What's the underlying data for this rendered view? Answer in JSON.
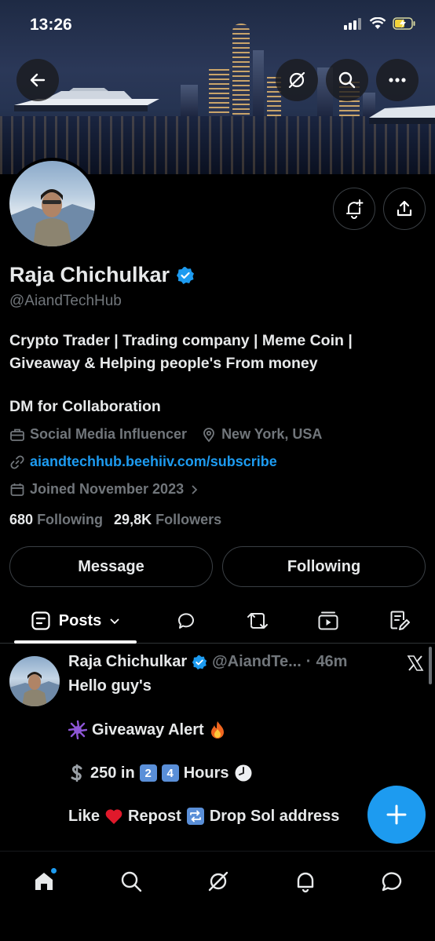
{
  "status_bar": {
    "time": "13:26"
  },
  "profile": {
    "name": "Raja Chichulkar",
    "handle": "@AiandTechHub",
    "bio_line1": "Crypto Trader | Trading company | Meme Coin |",
    "bio_line2": "Giveaway & Helping people's From money",
    "dm_line": "DM for Collaboration",
    "category": "Social Media Influencer",
    "location": "New York, USA",
    "website": "aiandtechhub.beehiiv.com/subscribe",
    "joined": "Joined November 2023",
    "following_count": "680",
    "following_label": "Following",
    "followers_count": "29,8K",
    "followers_label": "Followers"
  },
  "actions": {
    "message_label": "Message",
    "following_label": "Following"
  },
  "tabs": {
    "posts_label": "Posts"
  },
  "post": {
    "author": "Raja Chichulkar",
    "handle": "@AiandTe...",
    "separator": "·",
    "time": "46m",
    "line1": "Hello guy's",
    "line2": "Giveaway Alert",
    "line3_amount": "250 in",
    "line3_d1": "2",
    "line3_d2": "4",
    "line3_suffix": "Hours",
    "line4_a": "Like",
    "line4_b": "Repost",
    "line4_c": "Drop Sol address"
  },
  "colors": {
    "accent": "#1d9bf0",
    "background": "#000000",
    "muted": "#71767b",
    "text": "#e7e9ea"
  }
}
